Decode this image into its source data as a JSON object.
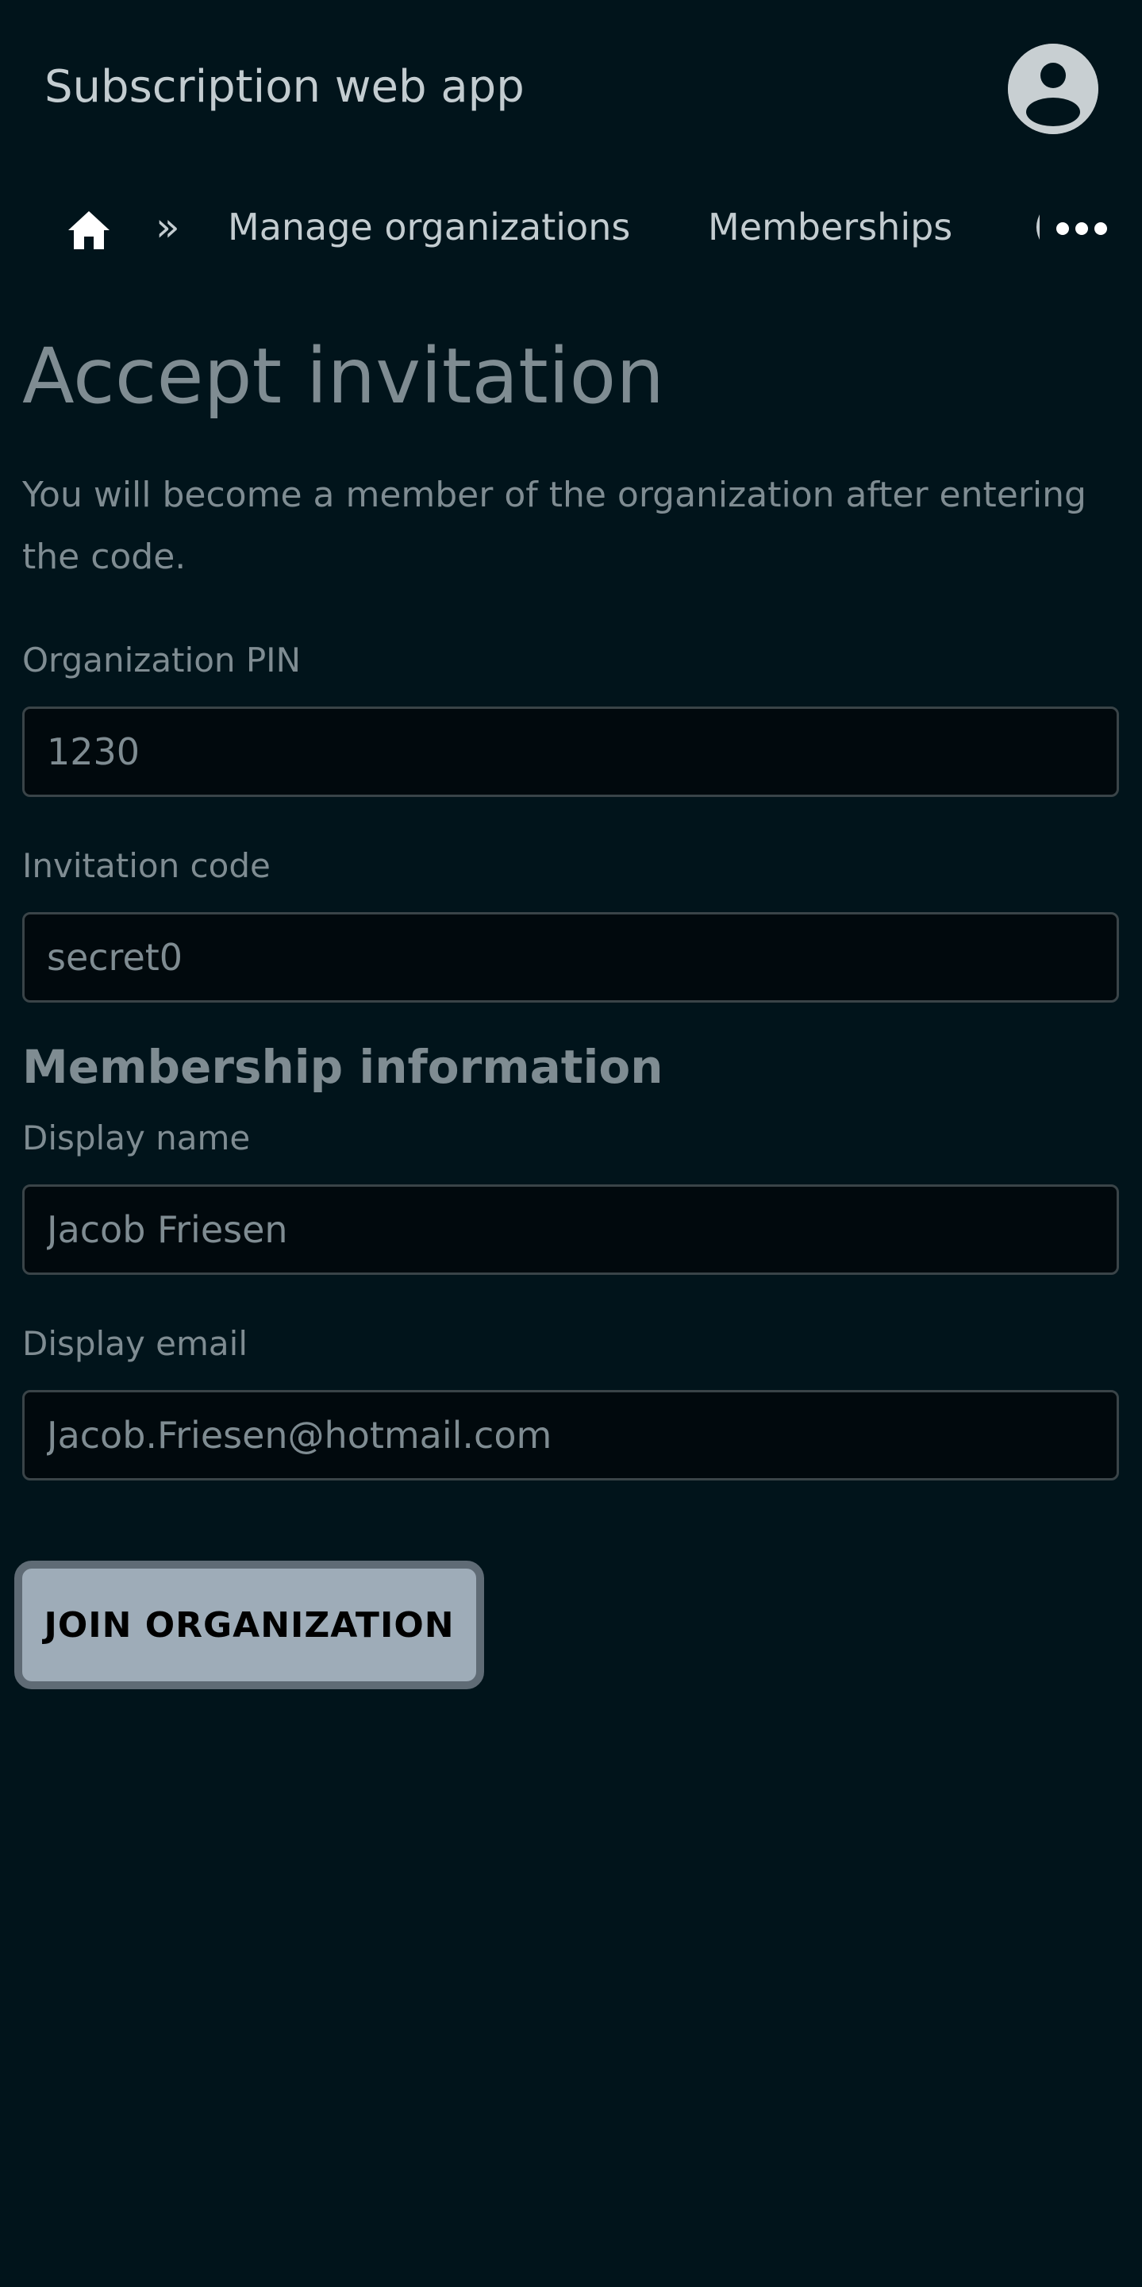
{
  "header": {
    "app_title": "Subscription web app",
    "avatar_icon": "user-circle-icon"
  },
  "breadcrumb": {
    "home_icon": "home-icon",
    "separator": "»",
    "items": [
      {
        "label": "Manage organizations"
      },
      {
        "label": "Memberships"
      }
    ],
    "truncated_item_glyph": "(",
    "more_icon": "ellipsis-icon"
  },
  "page": {
    "title": "Accept invitation",
    "intro": "You will become a member of the organization after entering the code."
  },
  "form": {
    "org_pin": {
      "label": "Organization PIN",
      "value": "1230"
    },
    "invitation_code": {
      "label": "Invitation code",
      "value": "secret0"
    },
    "membership_heading": "Membership information",
    "display_name": {
      "label": "Display name",
      "value": "Jacob Friesen"
    },
    "display_email": {
      "label": "Display email",
      "value": "Jacob.Friesen@hotmail.com"
    },
    "submit_label": "JOIN ORGANIZATION"
  },
  "colors": {
    "background": "#01141b",
    "text_muted": "#7f8c92",
    "button_bg": "#9eacb8",
    "button_border": "#5f6b75"
  }
}
